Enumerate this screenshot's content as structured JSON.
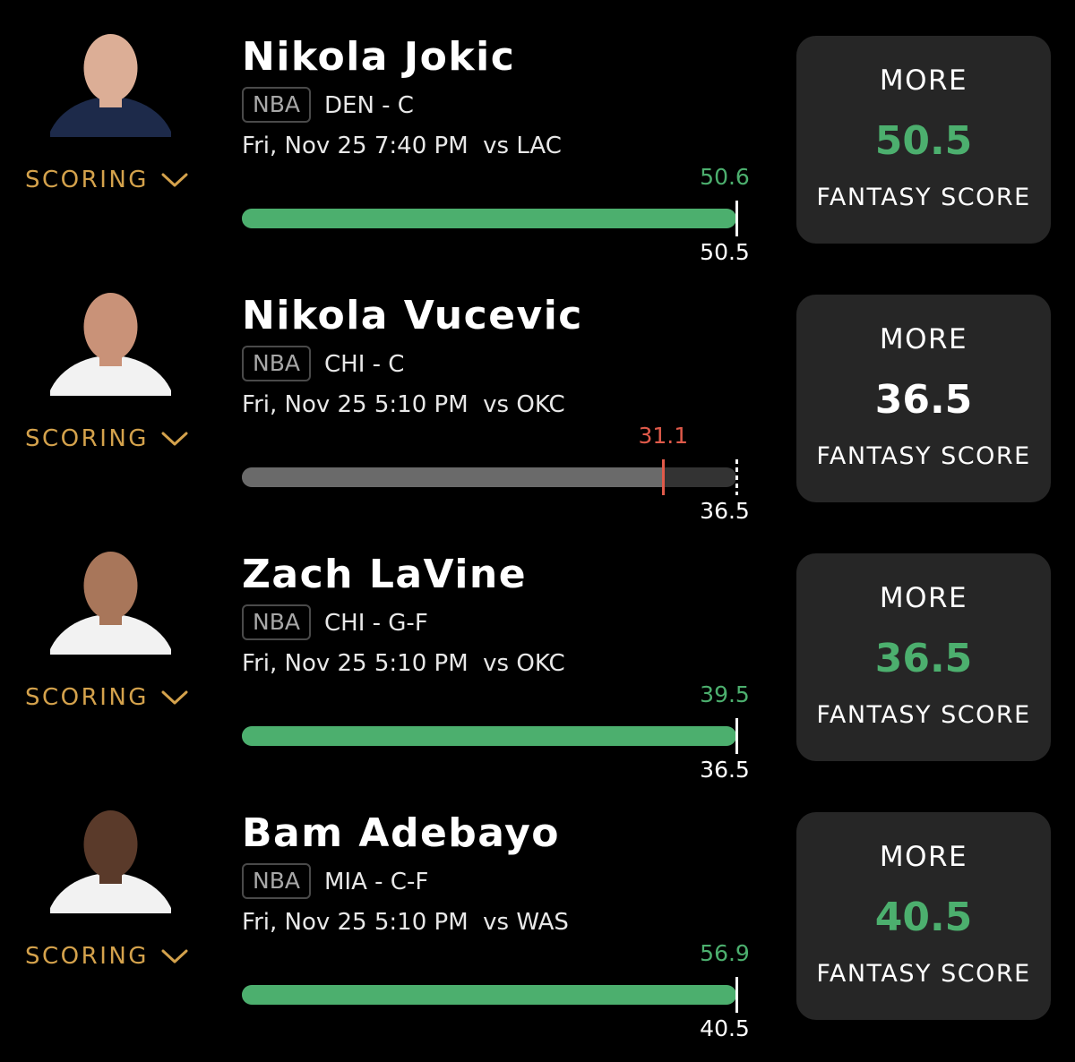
{
  "players": [
    {
      "name": "Nikola Jokic",
      "league": "NBA",
      "team": "DEN - C",
      "game": "Fri, Nov 25 7:40 PM  vs LAC",
      "scoring_label": "SCORING",
      "actual": "50.6",
      "line": "50.5",
      "progress": 1.0,
      "status": "hit",
      "pick_label": "MORE",
      "pick_value": "50.5",
      "stat_label": "FANTASY SCORE",
      "jersey_color": "#1d2a4a",
      "skin_color": "#dcae96"
    },
    {
      "name": "Nikola Vucevic",
      "league": "NBA",
      "team": "CHI - C",
      "game": "Fri, Nov 25 5:10 PM  vs OKC",
      "scoring_label": "SCORING",
      "actual": "31.1",
      "line": "36.5",
      "progress": 0.852,
      "status": "miss",
      "pick_label": "MORE",
      "pick_value": "36.5",
      "stat_label": "FANTASY SCORE",
      "jersey_color": "#f2f2f2",
      "skin_color": "#c99278"
    },
    {
      "name": "Zach LaVine",
      "league": "NBA",
      "team": "CHI - G-F",
      "game": "Fri, Nov 25 5:10 PM  vs OKC",
      "scoring_label": "SCORING",
      "actual": "39.5",
      "line": "36.5",
      "progress": 1.0,
      "status": "hit",
      "pick_label": "MORE",
      "pick_value": "36.5",
      "stat_label": "FANTASY SCORE",
      "jersey_color": "#f2f2f2",
      "skin_color": "#a8765a"
    },
    {
      "name": "Bam Adebayo",
      "league": "NBA",
      "team": "MIA - C-F",
      "game": "Fri, Nov 25 5:10 PM  vs WAS",
      "scoring_label": "SCORING",
      "actual": "56.9",
      "line": "40.5",
      "progress": 1.0,
      "status": "hit",
      "pick_label": "MORE",
      "pick_value": "40.5",
      "stat_label": "FANTASY SCORE",
      "jersey_color": "#f2f2f2",
      "skin_color": "#5a3a2a"
    }
  ],
  "colors": {
    "background": "#000000",
    "card": "#262626",
    "hit_green": "#4caf6e",
    "miss_red": "#e05a4a",
    "scoring_gold": "#d4a24c"
  }
}
